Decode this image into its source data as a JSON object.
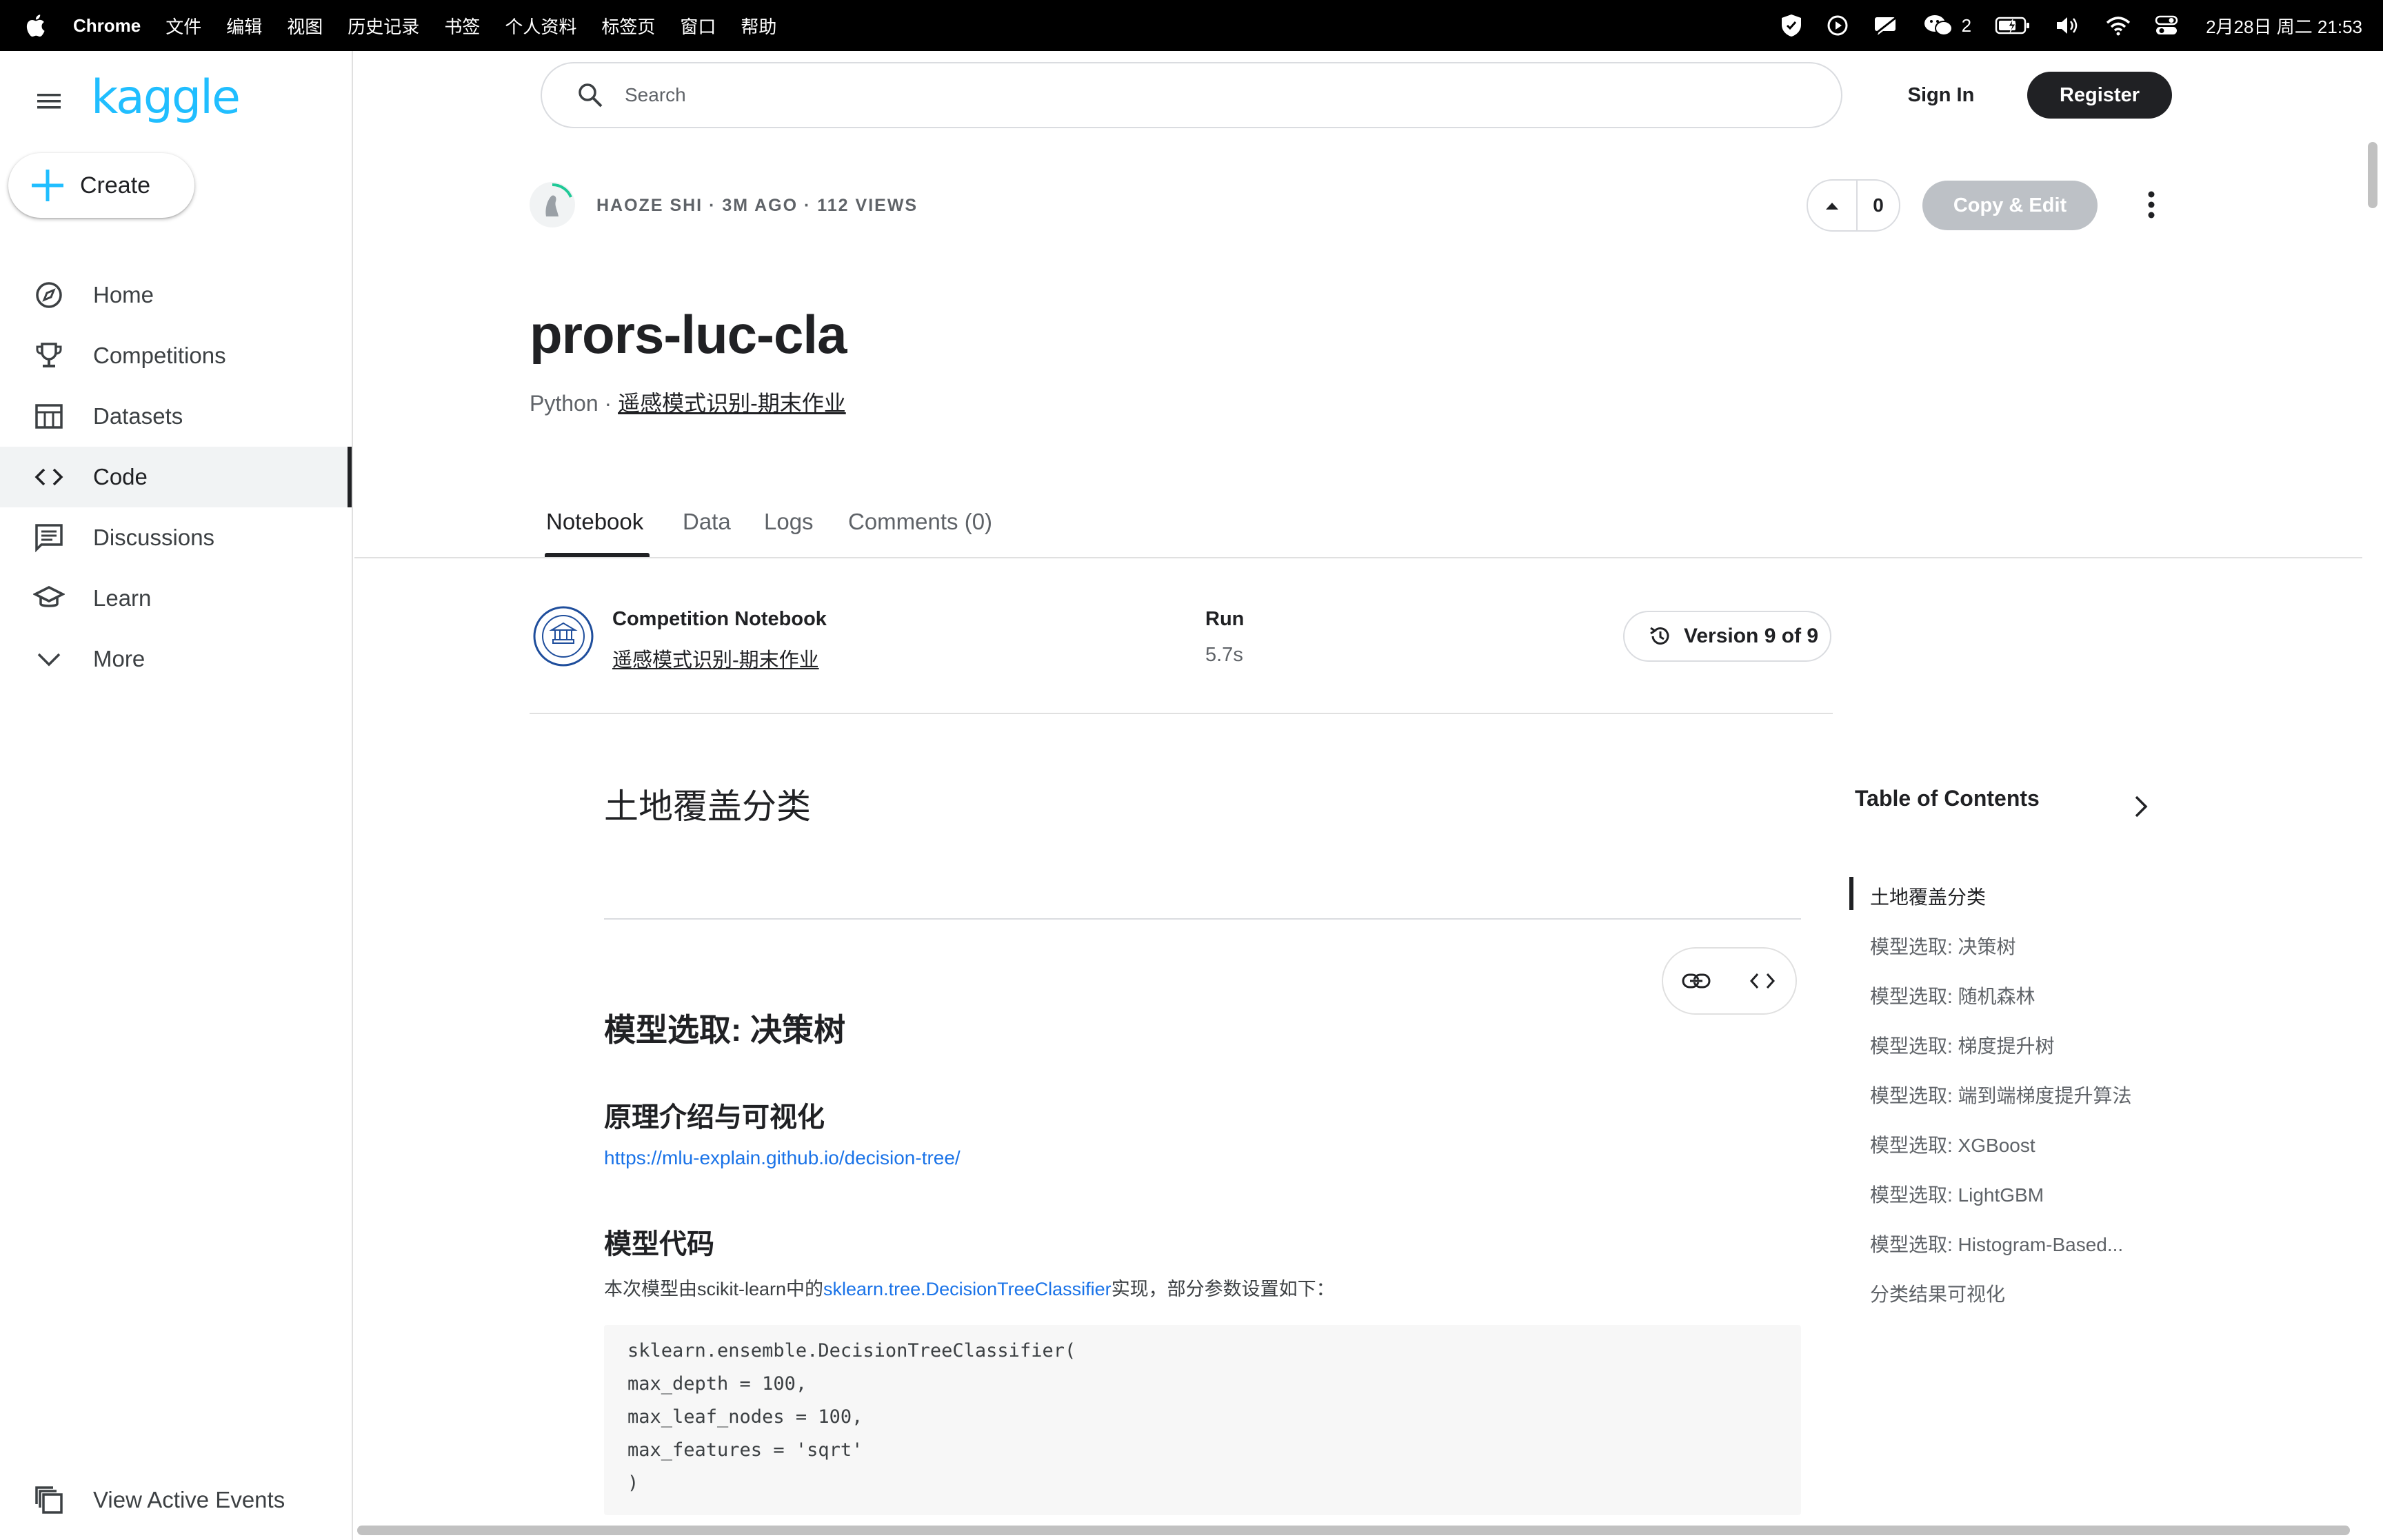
{
  "menubar": {
    "app_name": "Chrome",
    "items": [
      "文件",
      "编辑",
      "视图",
      "历史记录",
      "书签",
      "个人资料",
      "标签页",
      "窗口",
      "帮助"
    ],
    "wechat_count": "2",
    "clock": "2月28日 周二 21:53"
  },
  "sidebar": {
    "logo": "kaggle",
    "create_label": "Create",
    "items": [
      {
        "label": "Home",
        "icon": "compass-icon"
      },
      {
        "label": "Competitions",
        "icon": "trophy-icon"
      },
      {
        "label": "Datasets",
        "icon": "table-icon"
      },
      {
        "label": "Code",
        "icon": "code-icon",
        "active": true
      },
      {
        "label": "Discussions",
        "icon": "chat-icon"
      },
      {
        "label": "Learn",
        "icon": "school-icon"
      },
      {
        "label": "More",
        "icon": "chevron-down-icon"
      }
    ],
    "view_events_label": "View Active Events"
  },
  "header": {
    "search_placeholder": "Search",
    "signin_label": "Sign In",
    "register_label": "Register"
  },
  "notebook": {
    "meta": "HAOZE SHI · 3M AGO · 112 VIEWS",
    "vote_count": "0",
    "copy_edit_label": "Copy & Edit",
    "title": "prors-luc-cla",
    "language": "Python",
    "separator": " · ",
    "competition_link": "遥感模式识别-期末作业",
    "tabs": [
      {
        "label": "Notebook",
        "active": true
      },
      {
        "label": "Data"
      },
      {
        "label": "Logs"
      },
      {
        "label": "Comments (0)"
      }
    ],
    "competition_label": "Competition Notebook",
    "competition_name": "遥感模式识别-期末作业",
    "run_label": "Run",
    "run_value": "5.7s",
    "version_label": "Version 9 of 9"
  },
  "content": {
    "h_main": "土地覆盖分类",
    "h_model": "模型选取: 决策树",
    "h_principle": "原理介绍与可视化",
    "link_mlu": "https://mlu-explain.github.io/decision-tree/",
    "h_code": "模型代码",
    "para_before": "本次模型由scikit-learn中的",
    "para_link": "sklearn.tree.DecisionTreeClassifier",
    "para_after": "实现，部分参数设置如下：",
    "code_lines": [
      "sklearn.ensemble.DecisionTreeClassifier(",
      "max_depth = 100,",
      "max_leaf_nodes = 100,",
      "max_features = 'sqrt'",
      ")"
    ]
  },
  "toc": {
    "title": "Table of Contents",
    "items": [
      "土地覆盖分类",
      "模型选取: 决策树",
      "模型选取: 随机森林",
      "模型选取: 梯度提升树",
      "模型选取: 端到端梯度提升算法",
      "模型选取: XGBoost",
      "模型选取: LightGBM",
      "模型选取: Histogram-Based...",
      "分类结果可视化"
    ]
  }
}
